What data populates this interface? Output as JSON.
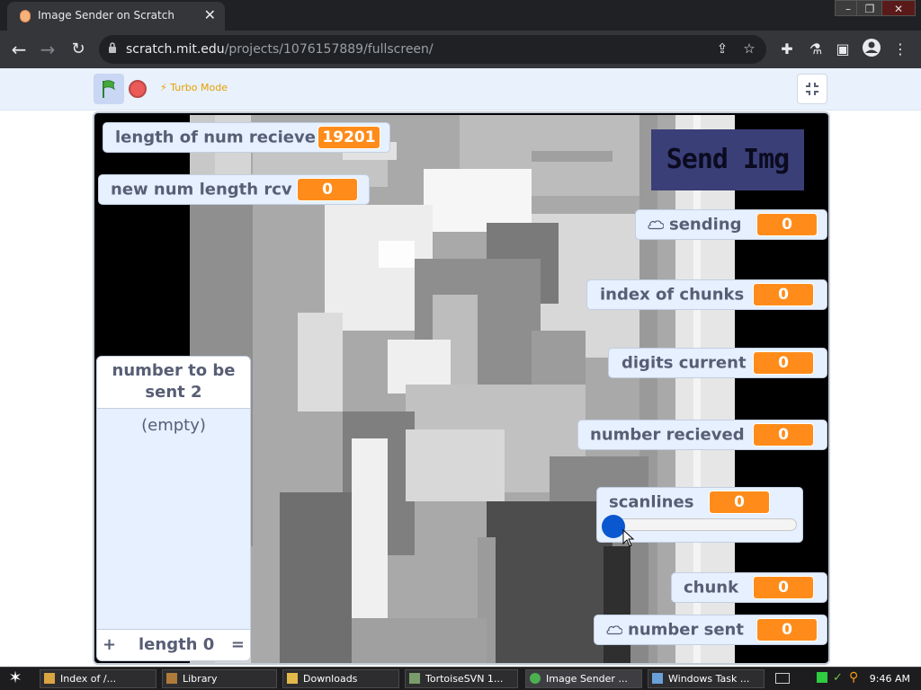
{
  "browser": {
    "tab_title": "Image Sender on Scratch",
    "url_host": "scratch.mit.edu",
    "url_path": "/projects/1076157889/fullscreen/",
    "window_controls": [
      "–",
      "❐",
      "✕"
    ]
  },
  "scratch": {
    "turbo_label": "Turbo Mode"
  },
  "stage": {
    "send_button_label": "Send Img",
    "monitors": {
      "length_recieve": {
        "label": "length of num recieve",
        "value": "19201"
      },
      "new_num_length": {
        "label": "new num length rcv",
        "value": "0"
      },
      "sending": {
        "label": "sending",
        "value": "0",
        "cloud": true
      },
      "index_of_chunks": {
        "label": "index of chunks",
        "value": "0"
      },
      "digits_current": {
        "label": "digits current",
        "value": "0"
      },
      "number_recieved": {
        "label": "number recieved",
        "value": "0"
      },
      "scanlines": {
        "label": "scanlines",
        "value": "0",
        "slider_fraction": 0
      },
      "chunk": {
        "label": "chunk",
        "value": "0"
      },
      "number_sent": {
        "label": "number sent",
        "value": "0",
        "cloud": true
      }
    },
    "list": {
      "title": "number to be sent 2",
      "empty_text": "(empty)",
      "add": "+",
      "length_text": "length 0",
      "resize": "="
    }
  },
  "taskbar": {
    "items": [
      {
        "label": "Index of /...",
        "icon": "folder-icon"
      },
      {
        "label": "Library",
        "icon": "library-icon"
      },
      {
        "label": "Downloads",
        "icon": "folder-icon"
      },
      {
        "label": "TortoiseSVN 1...",
        "icon": "tortoise-icon"
      },
      {
        "label": "Image Sender ...",
        "icon": "chrome-icon"
      },
      {
        "label": "Windows Task ...",
        "icon": "taskmgr-icon"
      }
    ],
    "clock": "9:46 AM"
  },
  "colors": {
    "monitor_value": "#ff8c1a",
    "monitor_bg": "#e6f0ff",
    "stop": "#ec5959",
    "slider_knob": "#0b57d0"
  }
}
